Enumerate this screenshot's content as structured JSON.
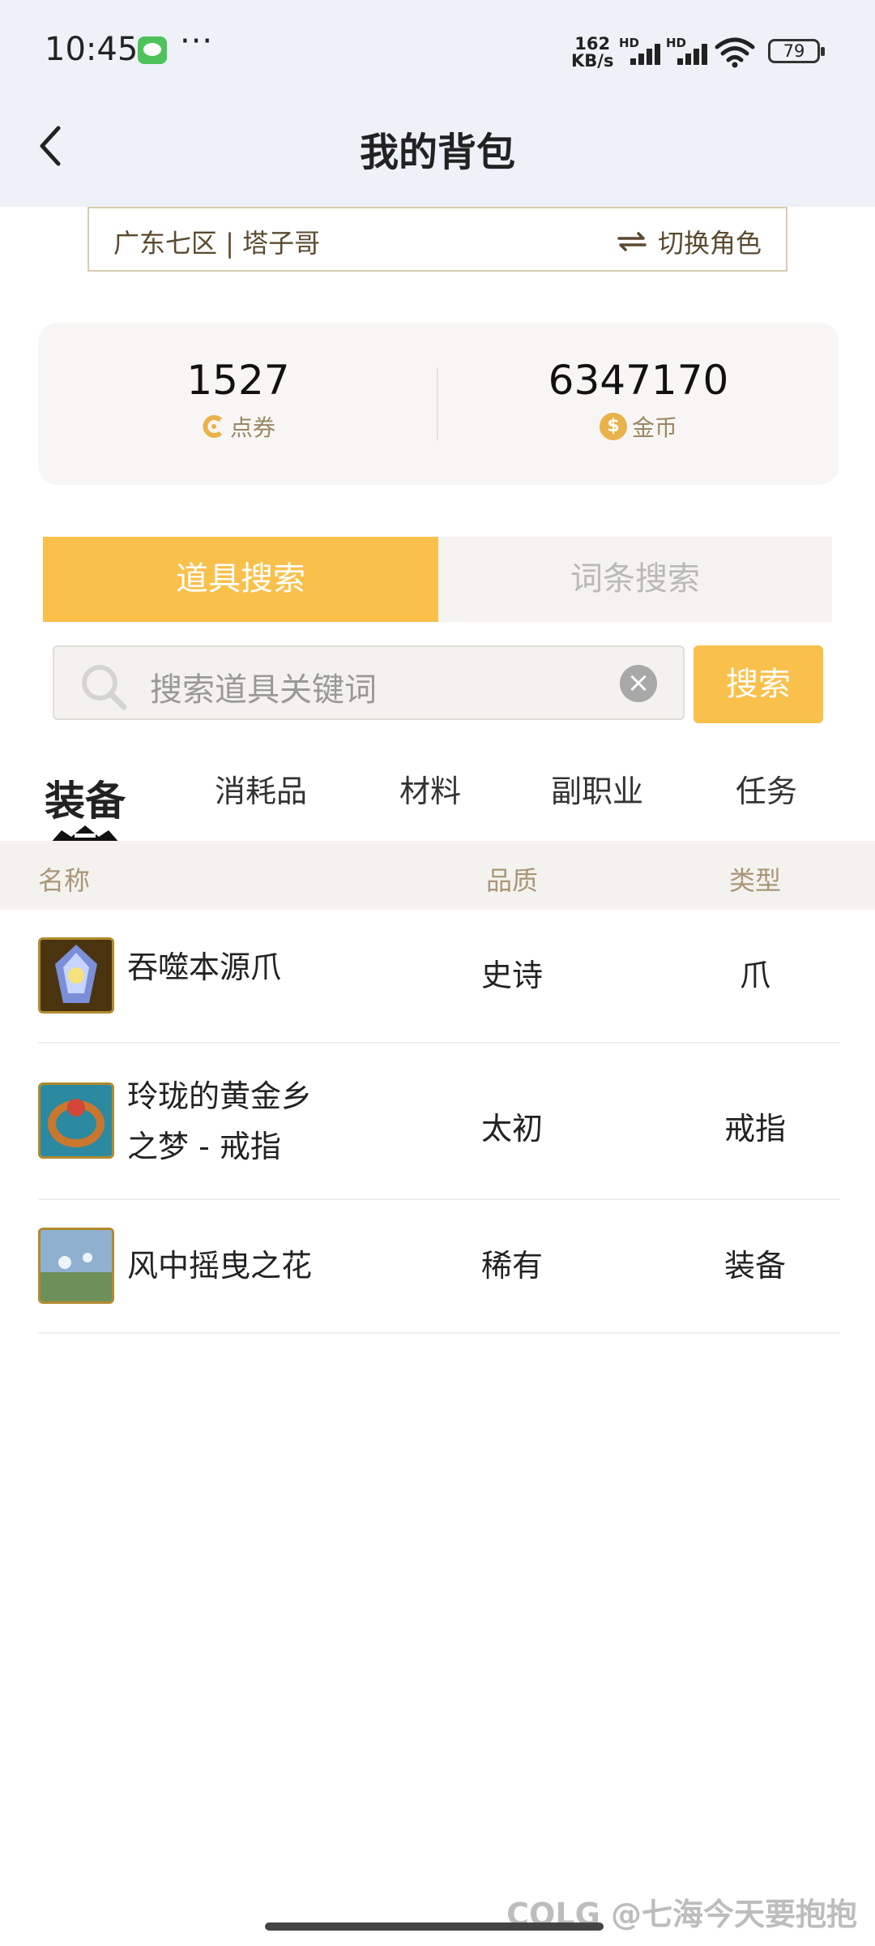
{
  "status_bar": {
    "time": "10:45",
    "net_speed_value": "162",
    "net_speed_unit": "KB/s",
    "hd_label": "HD",
    "battery": "79",
    "more": "···"
  },
  "nav": {
    "title": "我的背包"
  },
  "role_bar": {
    "server_role": "广东七区 | 塔子哥",
    "switch_label": "切换角色"
  },
  "currency": {
    "coupons": {
      "value": "1527",
      "label": "点券"
    },
    "gold": {
      "value": "6347170",
      "label": "金币",
      "icon_glyph": "$"
    }
  },
  "search_tabs": {
    "item_search": "道具搜索",
    "affix_search": "词条搜索",
    "active": "item_search"
  },
  "search": {
    "placeholder": "搜索道具关键词",
    "button_label": "搜索",
    "clear_glyph": "×"
  },
  "categories": {
    "equipment": "装备",
    "consumables": "消耗品",
    "materials": "材料",
    "sub_profession": "副职业",
    "quest": "任务",
    "active": "equipment"
  },
  "table": {
    "headers": {
      "name": "名称",
      "quality": "品质",
      "type": "类型"
    },
    "rows": [
      {
        "name": "吞噬本源爪",
        "quality": "史诗",
        "type": "爪"
      },
      {
        "name": "玲珑的黄金乡之梦 - 戒指",
        "quality": "太初",
        "type": "戒指"
      },
      {
        "name": "风中摇曳之花",
        "quality": "稀有",
        "type": "装备"
      }
    ]
  },
  "watermark": "COLG @七海今天要抱抱",
  "colors": {
    "accent": "#f9c04b",
    "header_bg": "#eef1f7",
    "label_brown": "#a99678"
  },
  "icons": [
    "back-icon",
    "wechat-icon",
    "wifi-icon",
    "signal-icon",
    "battery-icon",
    "switch-icon",
    "coupon-icon",
    "gold-coin-icon",
    "search-icon",
    "clear-icon",
    "claw-item-icon",
    "ring-item-icon",
    "flower-item-icon"
  ]
}
